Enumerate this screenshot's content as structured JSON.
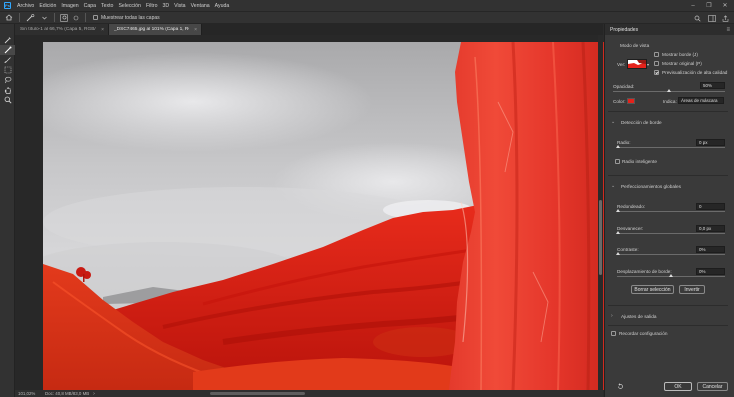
{
  "menubar": {
    "logo": "Ps",
    "items": [
      "Archivo",
      "Edición",
      "Imagen",
      "Capa",
      "Texto",
      "Selección",
      "Filtro",
      "3D",
      "Vista",
      "Ventana",
      "Ayuda"
    ]
  },
  "options": {
    "sample_all_layers_label": "Muestrear todas las capas"
  },
  "tabs": [
    {
      "label": "Sin título-1 al 66,7% (Capa 5, RGB/8#) *",
      "active": false
    },
    {
      "label": "_DSC7465.jpg al 101% (Capa 1, RGB/8) *",
      "active": true
    }
  ],
  "status": {
    "zoom": "101,02%",
    "doc": "Doc: 40,8 MB/83,0 MB"
  },
  "properties": {
    "title": "Propiedades",
    "view_mode_label": "Modo de vista",
    "view_label": "Ver:",
    "show_edge": "Mostrar borde (J)",
    "show_original": "Mostrar original (P)",
    "high_quality_preview": "Previsualización de alta calidad",
    "opacity_label": "Opacidad:",
    "opacity_value": "50%",
    "opacity_fraction": 0.5,
    "color_label": "Color:",
    "color_value": "#e4221b",
    "indicates_label": "Indica:",
    "indicates_value": "Áreas de máscara",
    "edge_detection": "Detección de borde",
    "radius_label": "Radio:",
    "radius_value": "0 px",
    "smart_radius": "Radio inteligente",
    "global_refinements": "Perfeccionamientos globales",
    "smooth_label": "Redondeado:",
    "smooth_value": "0",
    "feather_label": "Desvanecer:",
    "feather_value": "0,0 px",
    "contrast_label": "Contraste:",
    "contrast_value": "0%",
    "shift_edge_label": "Desplazamiento de borde:",
    "shift_edge_value": "0%",
    "clear_selection": "Borrar selección",
    "invert": "Invertir",
    "output_settings": "Ajustes de salida",
    "remember_settings": "Recordar configuración",
    "ok": "OK",
    "cancel": "Cancelar"
  },
  "colors": {
    "mask_red": "#e4221b",
    "panel_bg": "#3a3a3a",
    "accent": "#31a8ff"
  }
}
